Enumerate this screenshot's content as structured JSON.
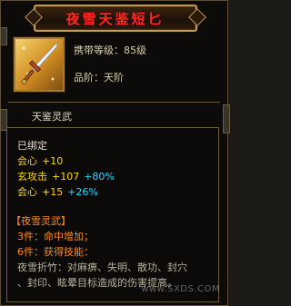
{
  "item": {
    "name": "夜雪天鉴短匕",
    "level_label": "携带等级：",
    "level_value": "85级",
    "grade_label": "品阶：",
    "grade_value": "天阶",
    "icon": "dagger-icon"
  },
  "spirit": {
    "label": "天鉴灵武"
  },
  "stats": {
    "bound": "已绑定",
    "lines": [
      {
        "name": "会心",
        "value": "+10",
        "bonus": ""
      },
      {
        "name": "玄攻击",
        "value": "+107",
        "bonus": "+80%"
      },
      {
        "name": "会心",
        "value": "+15",
        "bonus": "+26%"
      }
    ]
  },
  "set": {
    "title": "【夜雪灵武】",
    "pieces": [
      {
        "label": "3件：",
        "text": "命中增加；"
      },
      {
        "label": "6件：",
        "text": "获得技能："
      }
    ],
    "skill_line1": "夜雪折竹：对麻痹、失明、散功、封穴",
    "skill_line2": "、封印、眩晕目标造成的伤害提高。"
  },
  "watermark": "www.SXDS.COM",
  "colors": {
    "title": "#ff2a1e",
    "set_text": "#ff8a1d",
    "bonus": "#2fd5ff",
    "stat": "#ffd800"
  }
}
